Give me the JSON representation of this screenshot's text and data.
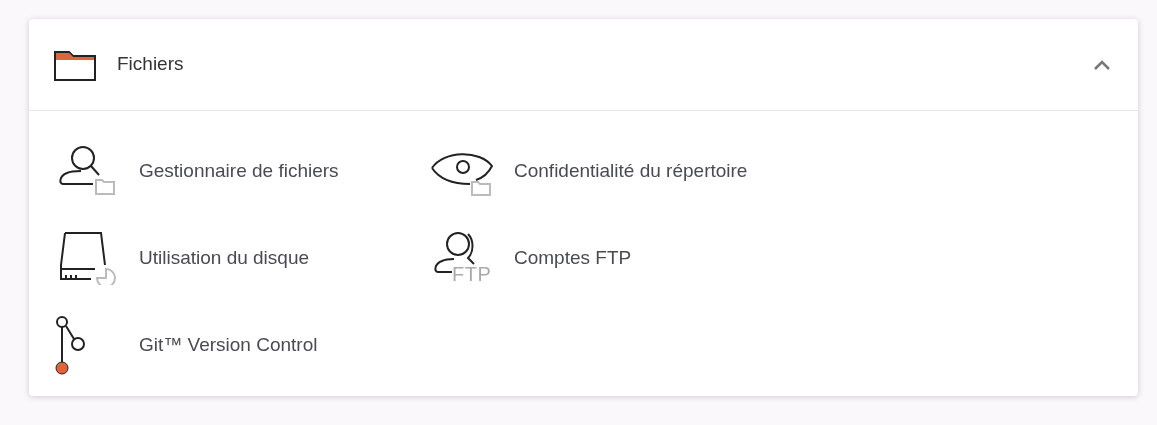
{
  "panel": {
    "title": "Fichiers",
    "expanded": true,
    "items": [
      {
        "label": "Gestionnaire de fichiers",
        "kind": "user-folder"
      },
      {
        "label": "Confidentialité du répertoire",
        "kind": "eye-folder"
      },
      {
        "label": "Utilisation du disque",
        "kind": "disk"
      },
      {
        "label": "Comptes FTP",
        "kind": "user-ftp",
        "icon_text": "FTP"
      },
      {
        "label": "Git™ Version Control",
        "kind": "git"
      }
    ]
  }
}
